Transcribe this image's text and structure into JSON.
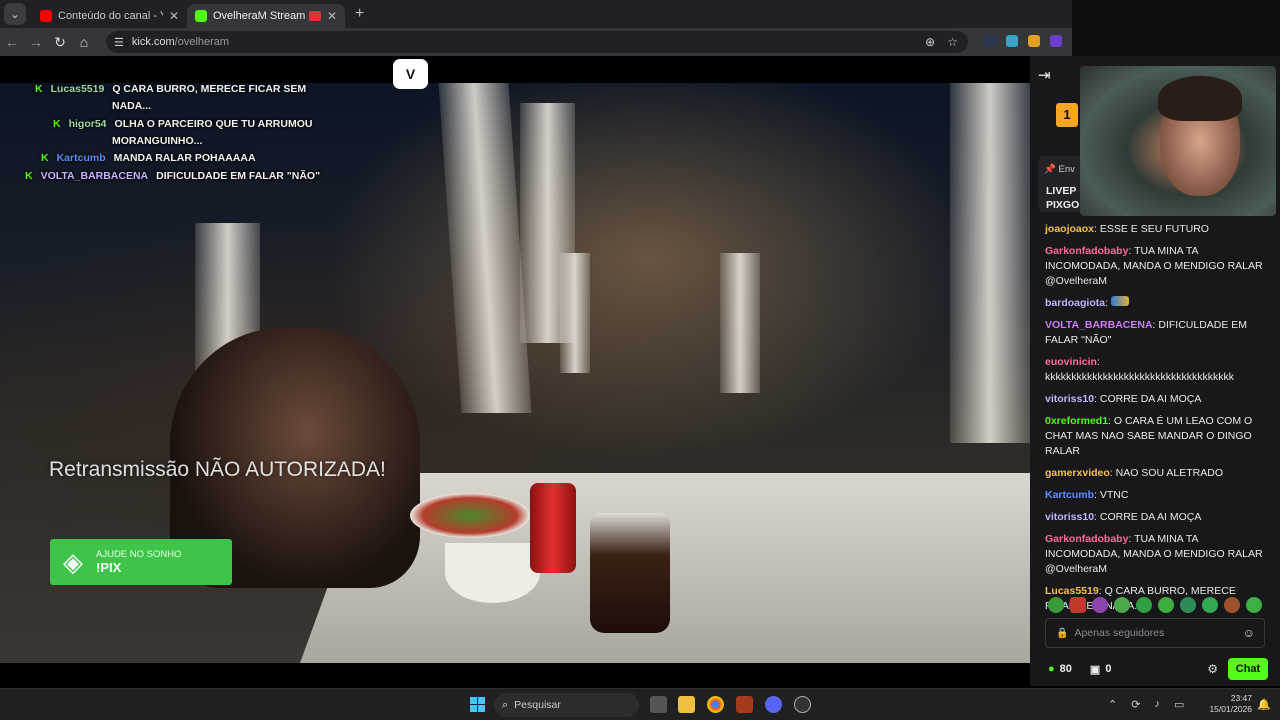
{
  "browser": {
    "tabs": [
      {
        "title": "Conteúdo do canal - YouTube S"
      },
      {
        "title": "OvelheraM Stream - Watch"
      }
    ],
    "url_host": "kick.com",
    "url_path": "/ovelheram"
  },
  "video": {
    "overlay_chat": [
      {
        "user": "Lucas5519",
        "user_color": "#b8e0b0",
        "text": "Q CARA BURRO, MERECE FICAR SEM",
        "text2": "NADA..."
      },
      {
        "user": "higor54",
        "user_color": "#b8e0b0",
        "text": "OLHA O PARCEIRO QUE TU ARRUMOU",
        "text2": "MORANGUINHO..."
      },
      {
        "user": "Kartcumb",
        "user_color": "#5b8dff",
        "text": "MANDA RALAR POHAAAAA",
        "text2": ""
      },
      {
        "user": "VOLTA_BARBACENA",
        "user_color": "#c7b2ff",
        "text": "DIFICULDADE EM FALAR \"NÃO\"",
        "text2": ""
      }
    ],
    "watermark": "Retransmissão NÃO AUTORIZADA!",
    "pix_line1": "AJUDE NO SONHO",
    "pix_line2": "!PIX"
  },
  "chat": {
    "sub_badge": "1",
    "pinned_label": "Env",
    "pinned_line1": "LIVEP",
    "pinned_line2": "PIXGO",
    "messages": [
      {
        "user": "joaojoaox",
        "color": "#f5c04a",
        "text": "ESSE E SEU FUTURO"
      },
      {
        "user": "Garkonfadobaby",
        "color": "#ff6b9d",
        "text": "TUA MINA TA INCOMODADA, MANDA O MENDIGO RALAR @OvelheraM"
      },
      {
        "user": "bardoagiota",
        "color": "#c5b2ff",
        "text": ""
      },
      {
        "user": "VOLTA_BARBACENA",
        "color": "#d07bff",
        "text": "DIFICULDADE EM FALAR \"NÃO\""
      },
      {
        "user": "euovinicin",
        "color": "#ff6b9d",
        "text": "kkkkkkkkkkkkkkkkkkkkkkkkkkkkkkkkkkkk"
      },
      {
        "user": "vitoriss10",
        "color": "#c5b2ff",
        "text": "CORRE DA AI MOÇA"
      },
      {
        "user": "0xreformed1",
        "color": "#53fc18",
        "text": "O CARA É UM LEAO COM O CHAT MAS NAO SABE MANDAR O DINGO RALAR"
      },
      {
        "user": "gamerxvideo",
        "color": "#f5c04a",
        "text": "NAO SOU ALETRADO"
      },
      {
        "user": "Kartcumb",
        "color": "#5b8dff",
        "text": "VTNC"
      },
      {
        "user": "vitoriss10",
        "color": "#c5b2ff",
        "text": "CORRE DA AI MOÇA"
      },
      {
        "user": "Garkonfadobaby",
        "color": "#ff6b9d",
        "text": "TUA MINA TA INCOMODADA, MANDA O MENDIGO RALAR @OvelheraM"
      },
      {
        "user": "Lucas5519",
        "color": "#f5c04a",
        "text": "Q CARA BURRO, MERECE FICAR SEM NADA...."
      }
    ],
    "input_placeholder": "Apenas seguidores",
    "points": "80",
    "gifts": "0",
    "chat_button": "Chat"
  },
  "taskbar": {
    "search_placeholder": "Pesquisar",
    "time": "23:47",
    "date": "15/01/2026"
  }
}
